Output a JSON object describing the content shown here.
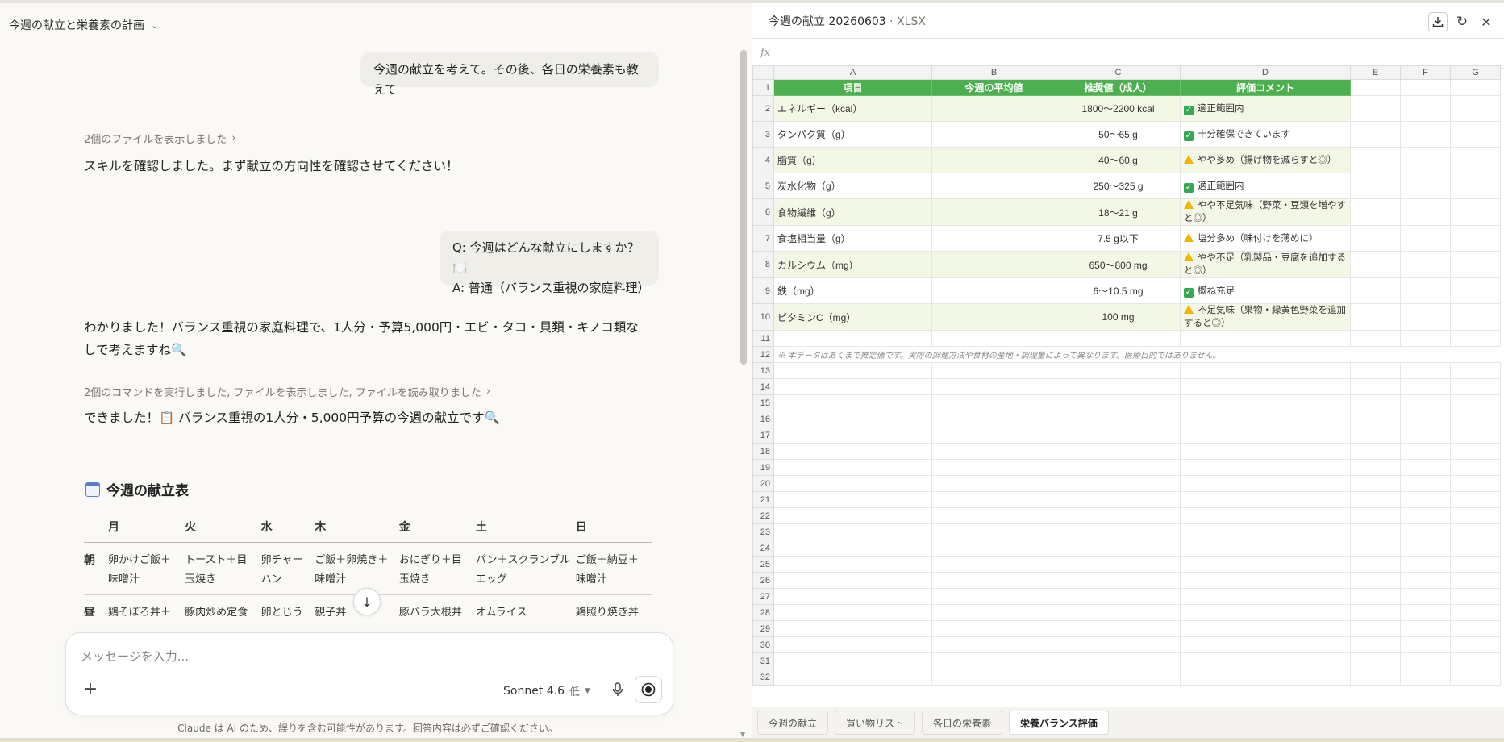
{
  "chat": {
    "title": "今週の献立と栄養素の計画",
    "user_message_1": "今週の献立を考えて。その後、各日の栄養素も教えて",
    "meta_1": "2個のファイルを表示しました",
    "assistant_1": "スキルを確認しました。まず献立の方向性を確認させてください！",
    "user_message_2_q": "Q: 今週はどんな献立にしますか？🍽️",
    "user_message_2_a": "A: 普通（バランス重視の家庭料理）",
    "assistant_2": "わかりました！バランス重視の家庭料理で、1人分・予算5,000円・エビ・タコ・貝類・キノコ類なしで考えますね🔍",
    "meta_2": "2個のコマンドを実行しました, ファイルを表示しました, ファイルを読み取りました",
    "assistant_3": "できました！📋 バランス重視の1人分・5,000円予算の今週の献立です🔍",
    "menu_heading": "今週の献立表",
    "menu_days": [
      "月",
      "火",
      "水",
      "木",
      "金",
      "土",
      "日"
    ],
    "menu_rows": [
      {
        "label": "朝",
        "cells": [
          "卵かけご飯＋味噌汁",
          "トースト＋目玉焼き",
          "卵チャーハン",
          "ご飯＋卵焼き＋味噌汁",
          "おにぎり＋目玉焼き",
          "パン＋スクランブルエッグ",
          "ご飯＋納豆＋味噌汁"
        ]
      },
      {
        "label": "昼",
        "cells": [
          "鶏そぼろ丼＋味噌汁",
          "豚肉炒め定食",
          "卵とじうどん",
          "親子丼",
          "豚バラ大根丼",
          "オムライス",
          "鶏照り焼き丼"
        ]
      }
    ],
    "composer_placeholder": "メッセージを入力...",
    "model_name": "Sonnet 4.6",
    "effort": "低",
    "disclaimer": "Claude は AI のため、誤りを含む可能性があります。回答内容は必ずご確認ください。",
    "icons": {
      "plus": "plus-icon",
      "mic": "mic-icon",
      "voice": "voice-mode-icon",
      "scroll": "arrow-down-icon"
    }
  },
  "sheet": {
    "file_name": "今週の献立 20260603",
    "file_ext": "· XLSX",
    "fx_label": "fx",
    "columns": [
      "A",
      "B",
      "C",
      "D",
      "E",
      "F",
      "G"
    ],
    "header_row": [
      "項目",
      "今週の平均値",
      "推奨値（成人）",
      "評価コメント"
    ],
    "rows": [
      {
        "item": "エネルギー（kcal）",
        "avg": "",
        "rec": "1800〜2200 kcal",
        "status": "ok",
        "comment": "適正範囲内"
      },
      {
        "item": "タンパク質（g）",
        "avg": "",
        "rec": "50〜65 g",
        "status": "ok",
        "comment": "十分確保できています"
      },
      {
        "item": "脂質（g）",
        "avg": "",
        "rec": "40〜60 g",
        "status": "warn",
        "comment": "やや多め（揚げ物を減らすと◎）"
      },
      {
        "item": "炭水化物（g）",
        "avg": "",
        "rec": "250〜325 g",
        "status": "ok",
        "comment": "適正範囲内"
      },
      {
        "item": "食物繊維（g）",
        "avg": "",
        "rec": "18〜21 g",
        "status": "warn",
        "comment": "やや不足気味（野菜・豆類を増やすと◎）"
      },
      {
        "item": "食塩相当量（g）",
        "avg": "",
        "rec": "7.5 g以下",
        "status": "warn",
        "comment": "塩分多め（味付けを薄めに）"
      },
      {
        "item": "カルシウム（mg）",
        "avg": "",
        "rec": "650〜800 mg",
        "status": "warn",
        "comment": "やや不足（乳製品・豆腐を追加すると◎）"
      },
      {
        "item": "鉄（mg）",
        "avg": "",
        "rec": "6〜10.5 mg",
        "status": "ok",
        "comment": "概ね充足"
      },
      {
        "item": "ビタミンC（mg）",
        "avg": "",
        "rec": "100 mg",
        "status": "warn",
        "comment": "不足気味（果物・緑黄色野菜を追加すると◎）"
      }
    ],
    "note": "※ 本データはあくまで推定値です。実際の調理方法や食材の産地・調理量によって異なります。医療目的ではありません。",
    "row_numbers_last": 32,
    "tabs": [
      "今週の献立",
      "買い物リスト",
      "各日の栄養素",
      "栄養バランス評価"
    ],
    "active_tab": 3,
    "colors": {
      "header_green": "#4caf50",
      "band": "#f3f8e6",
      "ok": "#34a853",
      "warn": "#f4b400"
    },
    "icons": {
      "download": "download-icon",
      "refresh": "refresh-icon",
      "close": "close-icon"
    }
  }
}
